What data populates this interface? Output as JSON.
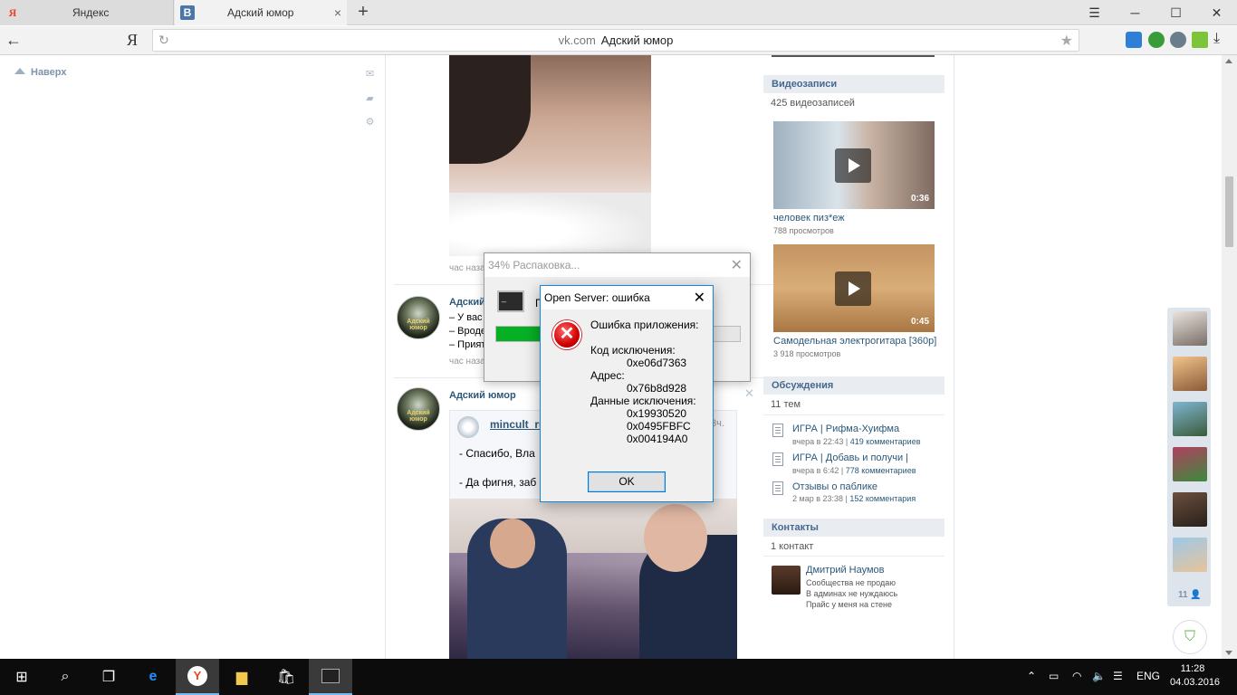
{
  "browser": {
    "tabs": [
      {
        "label": "Яндекс",
        "favicon": "yandex-icon"
      },
      {
        "label": "Адский юмор",
        "favicon": "vk-icon"
      }
    ],
    "tab_close": "×",
    "new_tab": "+",
    "window_controls": {
      "minimize": "─",
      "maximize": "☐",
      "close": "✕"
    },
    "ya_button": "Я",
    "url": {
      "domain": "vk.com",
      "page_title": "Адский юмор"
    },
    "back": "←"
  },
  "page": {
    "naverh": "Наверх",
    "posts": [
      {
        "time": "час назад"
      },
      {
        "author": "Адский юмор",
        "lines": [
          "– У вас",
          "– Вроде",
          "– Прият"
        ],
        "time": "час наза"
      },
      {
        "author": "Адский юмор",
        "avatar_text": "Адский юмор",
        "repost": {
          "name": "mincult_ru",
          "time": "3ч.",
          "lines": [
            "- Спасибо, Вла",
            "- Да фигня, заб"
          ]
        }
      }
    ]
  },
  "right": {
    "videos": {
      "header": "Видеозаписи",
      "count": "425 видеозаписей",
      "items": [
        {
          "title": "человек пиз*еж",
          "views": "788 просмотров",
          "duration": "0:36"
        },
        {
          "title": "Самодельная электрогитара [360p]",
          "views": "3 918 просмотров",
          "duration": "0:45"
        }
      ]
    },
    "discussions": {
      "header": "Обсуждения",
      "count": "11 тем",
      "items": [
        {
          "title": "ИГРА | Рифма-Хуифма",
          "date": "вчера в 22:43",
          "comments": "419 комментариев"
        },
        {
          "title": "ИГРА | Добавь и получи |",
          "date": "вчера в 6:42",
          "comments": "778 комментариев"
        },
        {
          "title": "Отзывы о паблике",
          "date": "2 мар в 23:38",
          "comments": "152 комментария"
        }
      ]
    },
    "contacts": {
      "header": "Контакты",
      "count": "1 контакт",
      "person": {
        "name": "Дмитрий Наумов",
        "lines": [
          "Сообщества не продаю",
          "В админах не нуждаюсь",
          "Прайс у меня на стене"
        ]
      }
    }
  },
  "friends_panel": {
    "count": "11"
  },
  "unpack_window": {
    "title": "34% Распаковка...",
    "label": "П",
    "progress": 0.34,
    "close": "✕"
  },
  "error_dialog": {
    "title": "Open Server: ошибка",
    "close": "✕",
    "message": "Ошибка приложения:",
    "code_label": "Код исключения:",
    "code_value": "0xe06d7363",
    "address_label": "Адрес:",
    "address_value": "0x76b8d928",
    "data_label": "Данные исключения:",
    "data_values": [
      "0x19930520",
      "0x0495FBFC",
      "0x004194A0"
    ],
    "ok": "OK"
  },
  "taskbar": {
    "lang": "ENG",
    "time": "11:28",
    "date": "04.03.2016"
  },
  "colors": {
    "vk_link": "#2b587a",
    "vk_header_bg": "#e9edf1",
    "progress_fill": "#06b025",
    "dialog_border": "#1883d7",
    "taskbar_bg": "#0c0c0c"
  }
}
